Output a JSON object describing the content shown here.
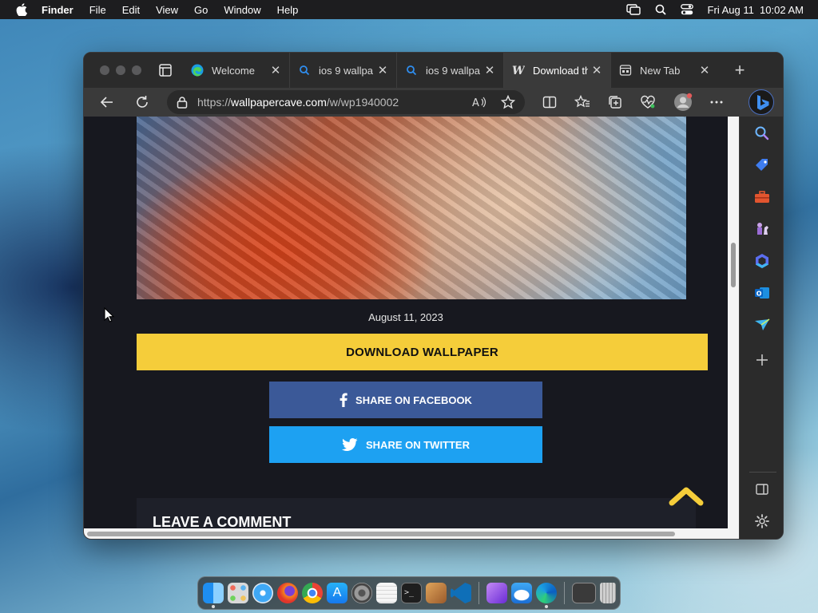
{
  "menubar": {
    "app_name": "Finder",
    "menus": [
      "File",
      "Edit",
      "View",
      "Go",
      "Window",
      "Help"
    ],
    "datetime": "Fri Aug 11  10:02 AM"
  },
  "browser": {
    "tabs": [
      {
        "label": "Welcome",
        "favicon": "edge-icon"
      },
      {
        "label": "ios 9 wallpa",
        "favicon": "search-icon"
      },
      {
        "label": "ios 9 wallpa",
        "favicon": "search-icon"
      },
      {
        "label": "Download th",
        "favicon": "wallpapercave-icon",
        "active": true
      },
      {
        "label": "New Tab",
        "favicon": "newtab-icon"
      }
    ],
    "url_prefix": "https://",
    "url_host": "wallpapercave.com",
    "url_path": "/w/wp1940002"
  },
  "page": {
    "date": "August 11, 2023",
    "download_label": "DOWNLOAD WALLPAPER",
    "share_facebook": "SHARE ON FACEBOOK",
    "share_twitter": "SHARE ON TWITTER",
    "comment_title": "LEAVE A COMMENT"
  },
  "colors": {
    "download": "#f5cd3a",
    "facebook": "#3b5998",
    "twitter": "#1da1f2",
    "page_bg": "#17181f"
  }
}
